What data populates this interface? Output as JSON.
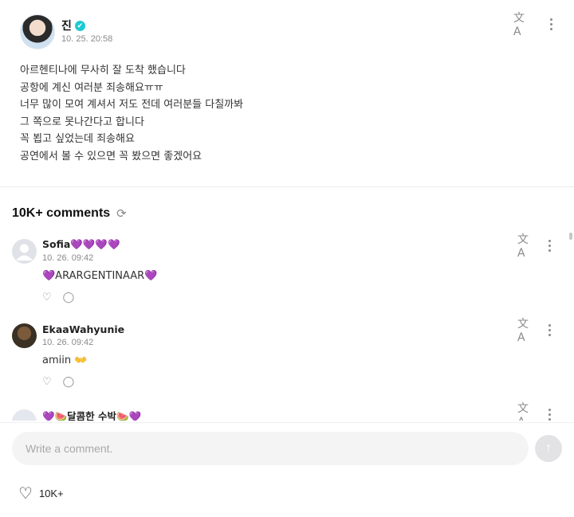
{
  "post": {
    "author": "진",
    "time": "10. 25. 20:58",
    "lines": [
      "아르헨티나에 무사히 잘 도착 했습니다",
      "공항에 계신 여러분 죄송해요ㅠㅠ",
      "너무 많이 모여 계셔서 저도 전데 여러분들 다칠까봐",
      "그 쪽으로 못나간다고 합니다",
      "꼭 뵙고 싶었는데 죄송해요",
      "공연에서 볼 수 있으면 꼭 봤으면 좋겠어요"
    ]
  },
  "icons": {
    "verified": "✔",
    "translate": "文A",
    "refresh": "⟳",
    "like": "♡",
    "reply": "◯",
    "send": "↑",
    "heart": "💜",
    "watermelon": "🍉",
    "hands": "👐"
  },
  "comments_header": {
    "title": "10K+ comments"
  },
  "comments": [
    {
      "name": "Sofia",
      "name_suffix": "💜💜💜💜",
      "time": "10. 26. 09:42",
      "text": "💜ARARGENTINAAR💜"
    },
    {
      "name": "EkaaWahyunie",
      "name_suffix": "",
      "time": "10. 26. 09:42",
      "text": "amiin 👐"
    },
    {
      "name": "💜🍉달콤한 수박🍉💜",
      "name_suffix": "",
      "time": "",
      "text": ""
    }
  ],
  "composer": {
    "placeholder": "Write a comment.",
    "like_count": "10K+"
  },
  "colors": {
    "verified": "#1ecad3",
    "heart": "#8b5cf6",
    "input_bg": "#f4f4f5"
  }
}
